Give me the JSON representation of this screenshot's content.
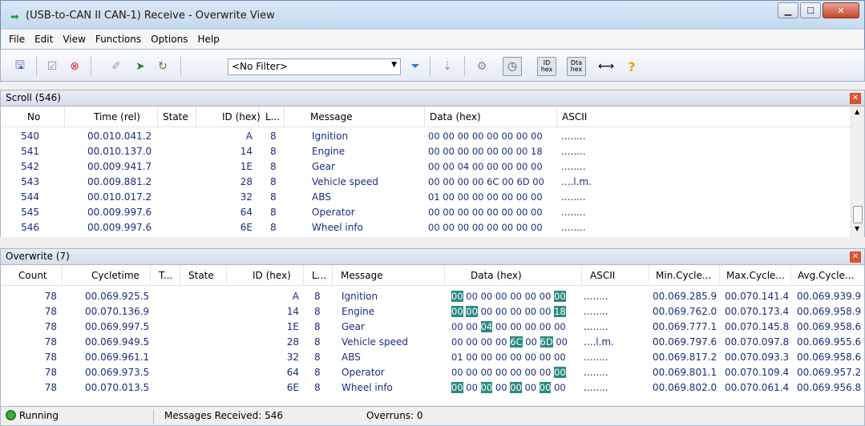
{
  "window": {
    "title": "(USB-to-CAN II  CAN-1) Receive - Overwrite View"
  },
  "menu": [
    "File",
    "Edit",
    "View",
    "Functions",
    "Options",
    "Help"
  ],
  "toolbar": {
    "filter_value": "<No Filter>",
    "id_hex_label": "ID hex",
    "data_hex_label": "Dta hex",
    "help_glyph": "?"
  },
  "scroll": {
    "title": "Scroll (546)",
    "columns": [
      "No",
      "Time (rel)",
      "State",
      "ID (hex)",
      "L...",
      "Message",
      "Data (hex)",
      "ASCII"
    ],
    "rows": [
      {
        "no": "540",
        "time": "00.010.041.2",
        "state": "",
        "id": "A",
        "len": "8",
        "msg": "Ignition",
        "data": "00 00 00 00 00 00 00 00",
        "ascii": "........"
      },
      {
        "no": "541",
        "time": "00.010.137.0",
        "state": "",
        "id": "14",
        "len": "8",
        "msg": "Engine",
        "data": "00 00 00 00 00 00 00 18",
        "ascii": "........"
      },
      {
        "no": "542",
        "time": "00.009.941.7",
        "state": "",
        "id": "1E",
        "len": "8",
        "msg": "Gear",
        "data": "00 00 04 00 00 00 00 00",
        "ascii": "........"
      },
      {
        "no": "543",
        "time": "00.009.881.2",
        "state": "",
        "id": "28",
        "len": "8",
        "msg": "Vehicle speed",
        "data": "00 00 00 00 6C 00 6D 00",
        "ascii": "....l.m."
      },
      {
        "no": "544",
        "time": "00.010.017.2",
        "state": "",
        "id": "32",
        "len": "8",
        "msg": "ABS",
        "data": "01 00 00 00 00 00 00 00",
        "ascii": "........"
      },
      {
        "no": "545",
        "time": "00.009.997.6",
        "state": "",
        "id": "64",
        "len": "8",
        "msg": "Operator",
        "data": "00 00 00 00 00 00 00 00",
        "ascii": "........"
      },
      {
        "no": "546",
        "time": "00.009.997.6",
        "state": "",
        "id": "6E",
        "len": "8",
        "msg": "Wheel info",
        "data": "00 00 00 00 00 00 00 00",
        "ascii": "........"
      }
    ]
  },
  "overwrite": {
    "title": "Overwrite (7)",
    "columns": [
      "Count",
      "Cycletime",
      "T...",
      "State",
      "ID (hex)",
      "L...",
      "Message",
      "Data (hex)",
      "ASCII",
      "Min.Cycle...",
      "Max.Cycle...",
      "Avg.Cycle..."
    ],
    "rows": [
      {
        "count": "78",
        "cycle": "00.069.925.5",
        "id": "A",
        "len": "8",
        "msg": "Ignition",
        "bytes": [
          "00",
          "00",
          "00",
          "00",
          "00",
          "00",
          "00",
          "00"
        ],
        "hl": [
          0,
          7
        ],
        "ascii": "........",
        "min": "00.069.285.9",
        "max": "00.070.141.4",
        "avg": "00.069.939.9"
      },
      {
        "count": "78",
        "cycle": "00.070.136.9",
        "id": "14",
        "len": "8",
        "msg": "Engine",
        "bytes": [
          "00",
          "00",
          "00",
          "00",
          "00",
          "00",
          "00",
          "18"
        ],
        "hl": [
          0,
          1,
          7
        ],
        "ascii": "........",
        "min": "00.069.762.0",
        "max": "00.070.173.4",
        "avg": "00.069.958.9"
      },
      {
        "count": "78",
        "cycle": "00.069.997.5",
        "id": "1E",
        "len": "8",
        "msg": "Gear",
        "bytes": [
          "00",
          "00",
          "04",
          "00",
          "00",
          "00",
          "00",
          "00"
        ],
        "hl": [
          2
        ],
        "ascii": "........",
        "min": "00.069.777.1",
        "max": "00.070.145.8",
        "avg": "00.069.958.6"
      },
      {
        "count": "78",
        "cycle": "00.069.949.5",
        "id": "28",
        "len": "8",
        "msg": "Vehicle speed",
        "bytes": [
          "00",
          "00",
          "00",
          "00",
          "6C",
          "00",
          "6D",
          "00"
        ],
        "hl": [
          4,
          6
        ],
        "ascii": "....l.m.",
        "min": "00.069.797.6",
        "max": "00.070.097.8",
        "avg": "00.069.955.6"
      },
      {
        "count": "78",
        "cycle": "00.069.961.1",
        "id": "32",
        "len": "8",
        "msg": "ABS",
        "bytes": [
          "01",
          "00",
          "00",
          "00",
          "00",
          "00",
          "00",
          "00"
        ],
        "hl": [],
        "ascii": "........",
        "min": "00.069.817.2",
        "max": "00.070.093.3",
        "avg": "00.069.958.6"
      },
      {
        "count": "78",
        "cycle": "00.069.973.5",
        "id": "64",
        "len": "8",
        "msg": "Operator",
        "bytes": [
          "00",
          "00",
          "00",
          "00",
          "00",
          "00",
          "00",
          "00"
        ],
        "hl": [
          7
        ],
        "ascii": "........",
        "min": "00.069.801.1",
        "max": "00.070.109.4",
        "avg": "00.069.957.2"
      },
      {
        "count": "78",
        "cycle": "00.070.013.5",
        "id": "6E",
        "len": "8",
        "msg": "Wheel info",
        "bytes": [
          "00",
          "00",
          "00",
          "00",
          "00",
          "00",
          "00",
          "00"
        ],
        "hl": [
          0,
          2,
          4,
          6
        ],
        "ascii": "........",
        "min": "00.069.802.0",
        "max": "00.070.061.4",
        "avg": "00.069.956.8"
      }
    ]
  },
  "status": {
    "state": "Running",
    "received": "Messages Received: 546",
    "overruns": "Overruns: 0"
  },
  "colors": {
    "text_blue": "#1a2c80",
    "highlight": "#2a8a82",
    "running_green": "#3db33d"
  }
}
